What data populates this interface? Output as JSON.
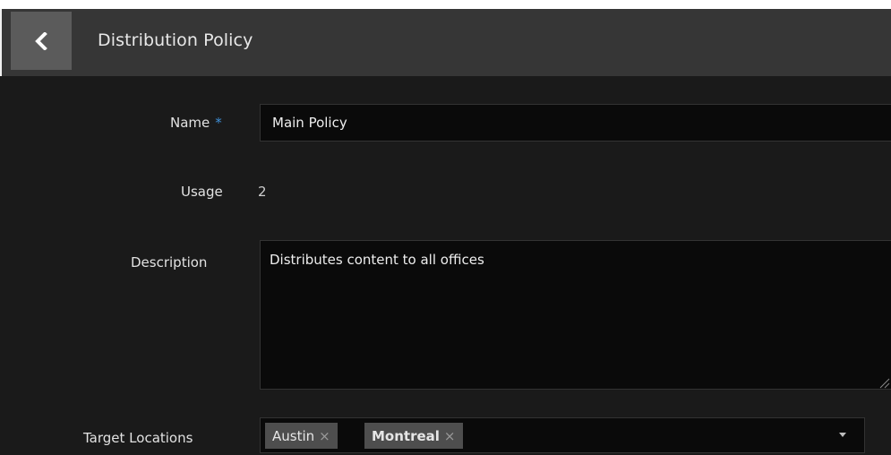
{
  "header": {
    "title": "Distribution Policy",
    "back_icon": "chevron-left-icon"
  },
  "form": {
    "name_label": "Name",
    "required_marker": "*",
    "name_value": "Main Policy",
    "usage_label": "Usage",
    "usage_value": "2",
    "description_label": "Description",
    "description_value": "Distributes content to all offices",
    "target_locations_label": "Target Locations",
    "target_locations": [
      {
        "label": "Austin",
        "remove": "×"
      },
      {
        "label": "Montreal",
        "remove": "×"
      }
    ]
  },
  "colors": {
    "header_bg": "#363636",
    "back_button_bg": "#5b5b5b",
    "page_bg": "#1a1a1a",
    "input_bg": "#0a0a0a",
    "tag_bg": "#4e4e4e",
    "required_accent": "#3f8fd6"
  }
}
